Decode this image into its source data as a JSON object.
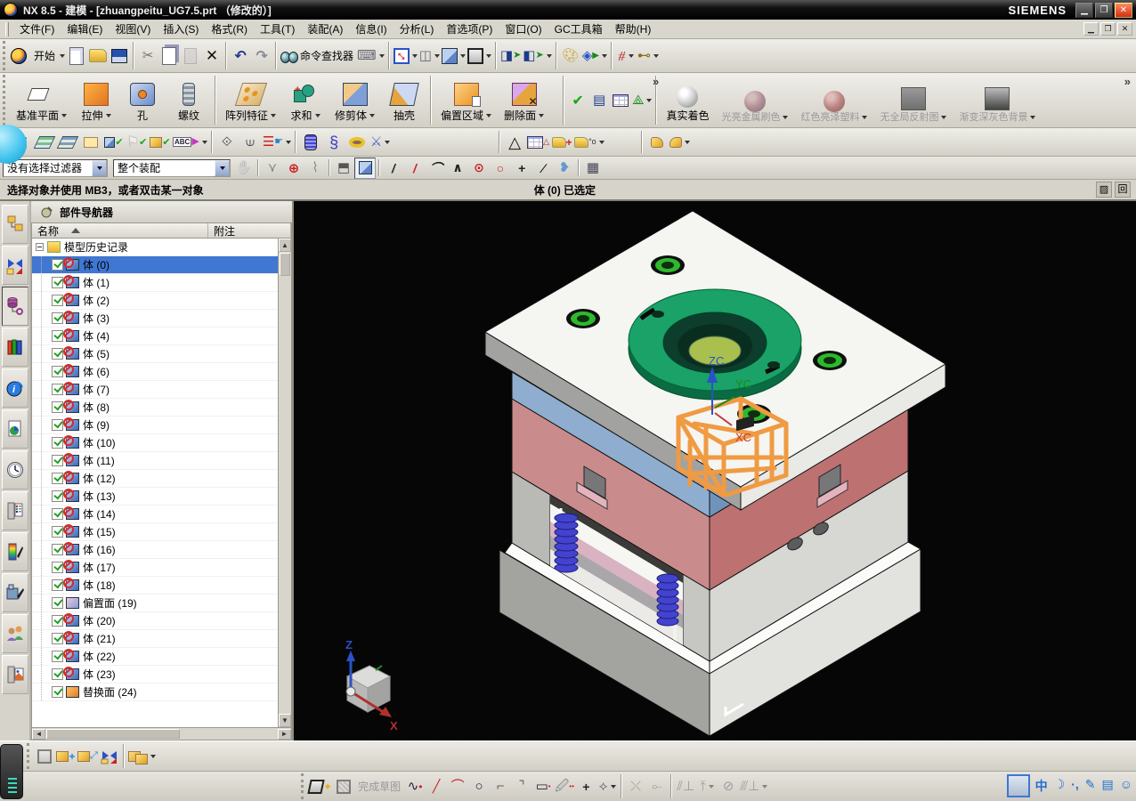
{
  "window": {
    "title": "NX 8.5 - 建模 - [zhuangpeitu_UG7.5.prt （修改的）]",
    "brand": "SIEMENS"
  },
  "menu": {
    "items": [
      "文件(F)",
      "编辑(E)",
      "视图(V)",
      "插入(S)",
      "格式(R)",
      "工具(T)",
      "装配(A)",
      "信息(I)",
      "分析(L)",
      "首选项(P)",
      "窗口(O)",
      "GC工具箱",
      "帮助(H)"
    ]
  },
  "toolbar_standard": {
    "start_label": "开始",
    "command_finder_label": "命令查找器",
    "overflow_glyph": "»"
  },
  "toolbar_feature": {
    "buttons": [
      {
        "label": "基准平面"
      },
      {
        "label": "拉伸"
      },
      {
        "label": "孔"
      },
      {
        "label": "螺纹"
      },
      {
        "label": "阵列特征"
      },
      {
        "label": "求和"
      },
      {
        "label": "修剪体"
      },
      {
        "label": "抽壳"
      },
      {
        "label": "偏置区域"
      },
      {
        "label": "删除面"
      }
    ],
    "render_styles": [
      {
        "label": "真实着色",
        "enabled": true
      },
      {
        "label": "光亮金属刷色",
        "enabled": false
      },
      {
        "label": "红色亮泽塑料",
        "enabled": false
      },
      {
        "label": "无全局反射图",
        "enabled": false
      },
      {
        "label": "渐变深灰色背景",
        "enabled": false
      }
    ]
  },
  "selection_bar": {
    "filter_value": "没有选择过滤器",
    "scope_value": "整个装配"
  },
  "status_bar": {
    "prompt": "选择对象并使用 MB3，或者双击某一对象",
    "status": "体 (0) 已选定"
  },
  "part_navigator": {
    "title": "部件导航器",
    "columns": {
      "name": "名称",
      "note": "附注"
    },
    "root_label": "模型历史记录",
    "items": [
      {
        "label": "体 (0)",
        "icon": "body",
        "selected": true
      },
      {
        "label": "体 (1)",
        "icon": "body"
      },
      {
        "label": "体 (2)",
        "icon": "body"
      },
      {
        "label": "体 (3)",
        "icon": "body"
      },
      {
        "label": "体 (4)",
        "icon": "body"
      },
      {
        "label": "体 (5)",
        "icon": "body"
      },
      {
        "label": "体 (6)",
        "icon": "body"
      },
      {
        "label": "体 (7)",
        "icon": "body"
      },
      {
        "label": "体 (8)",
        "icon": "body"
      },
      {
        "label": "体 (9)",
        "icon": "body"
      },
      {
        "label": "体 (10)",
        "icon": "body"
      },
      {
        "label": "体 (11)",
        "icon": "body"
      },
      {
        "label": "体 (12)",
        "icon": "body"
      },
      {
        "label": "体 (13)",
        "icon": "body"
      },
      {
        "label": "体 (14)",
        "icon": "body"
      },
      {
        "label": "体 (15)",
        "icon": "body"
      },
      {
        "label": "体 (16)",
        "icon": "body"
      },
      {
        "label": "体 (17)",
        "icon": "body"
      },
      {
        "label": "体 (18)",
        "icon": "body"
      },
      {
        "label": "偏置面 (19)",
        "icon": "offset-face"
      },
      {
        "label": "体 (20)",
        "icon": "body"
      },
      {
        "label": "体 (21)",
        "icon": "body"
      },
      {
        "label": "体 (22)",
        "icon": "body"
      },
      {
        "label": "体 (23)",
        "icon": "body"
      },
      {
        "label": "替换面 (24)",
        "icon": "replace-face"
      }
    ]
  },
  "viewport": {
    "wcs": {
      "zc": "ZC",
      "yc": "YC",
      "xc": "XC"
    },
    "triad": {
      "z": "Z",
      "x": "X"
    },
    "colors": {
      "top_plate": "#f5f5f2",
      "a_plate": "#8fadcf",
      "b_plate": "#c98b8b",
      "ring": "#1aa268",
      "spring": "#4343ce",
      "product": "#f09a42",
      "background": "#060606"
    }
  },
  "bottom": {
    "finish_sketch_label": "完成草图",
    "ime_lang": "中"
  }
}
